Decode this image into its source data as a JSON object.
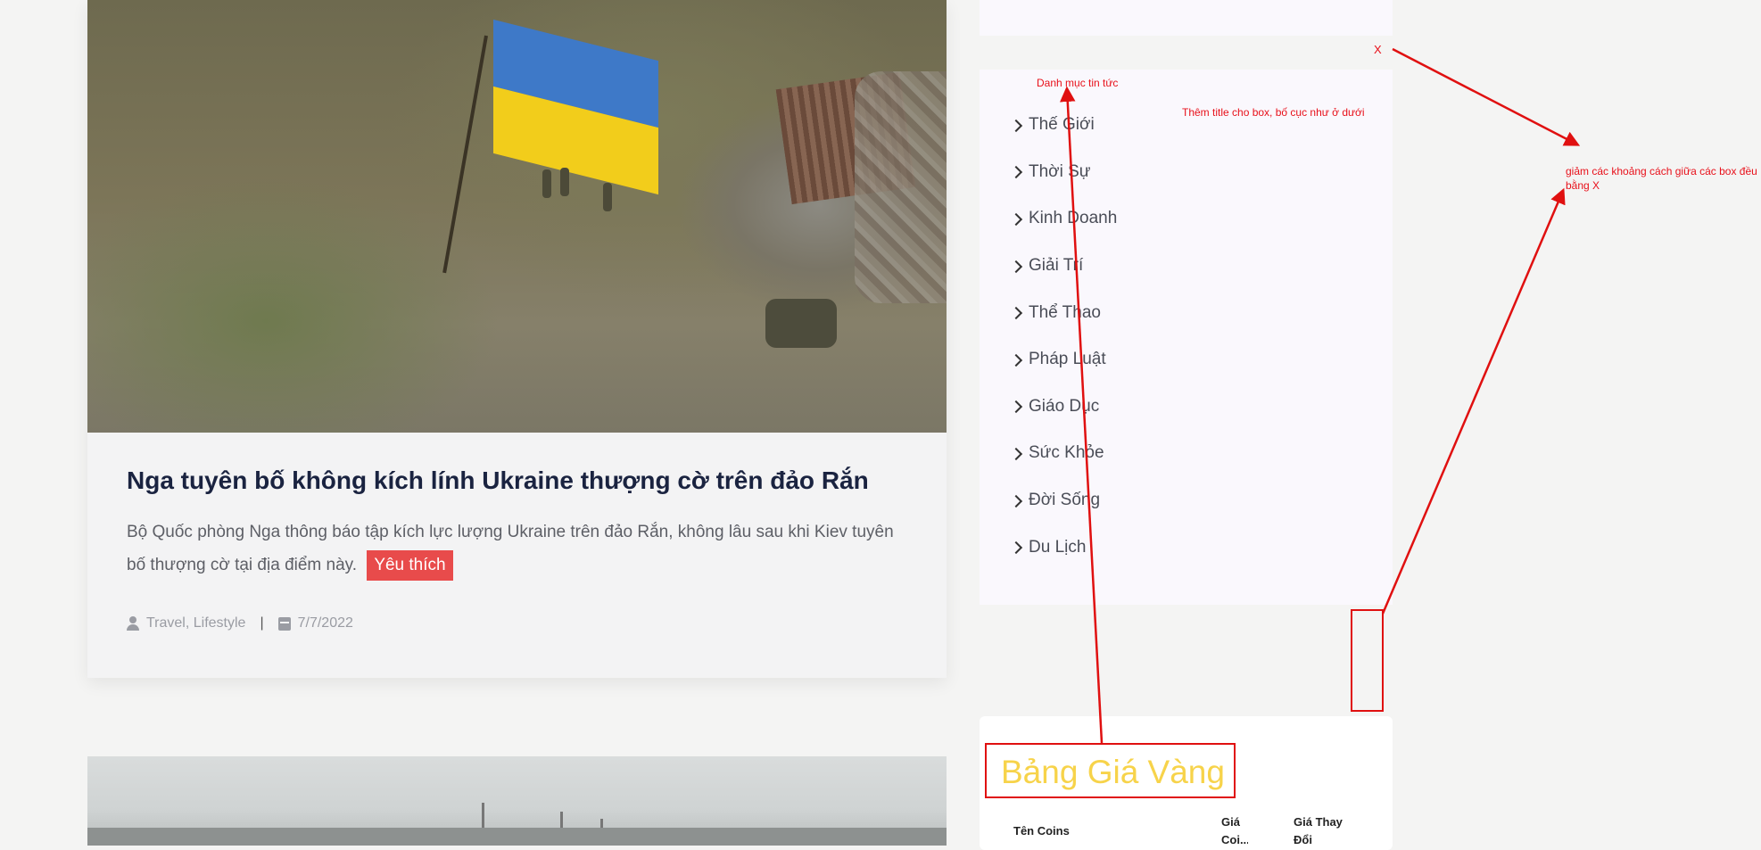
{
  "article": {
    "title": "Nga tuyên bố không kích lính Ukraine thượng cờ trên đảo Rắn",
    "excerpt": "Bộ Quốc phòng Nga thông báo tập kích lực lượng Ukraine trên đảo Rắn, không lâu sau khi Kiev tuyên bố thượng cờ tại địa điểm này.",
    "badge": "Yêu thích",
    "category": "Travel, Lifestyle",
    "separator": "|",
    "date": "7/7/2022"
  },
  "sidebar": {
    "categories": [
      {
        "label": "Thế Giới"
      },
      {
        "label": "Thời Sự"
      },
      {
        "label": "Kinh Doanh"
      },
      {
        "label": "Giải Trí"
      },
      {
        "label": "Thể Thao"
      },
      {
        "label": "Pháp Luật"
      },
      {
        "label": "Giáo Dục"
      },
      {
        "label": "Sức Khỏe"
      },
      {
        "label": "Đời Sống"
      },
      {
        "label": "Du Lịch"
      }
    ],
    "gold": {
      "title": "Bảng Giá Vàng",
      "columns": [
        "Tên Coins",
        "Giá Coi...",
        "Giá Thay Đổi"
      ]
    }
  },
  "annotations": {
    "x_marker": "X",
    "category_title_note": "Danh mục tin tức",
    "box_title_note": "Thêm title cho box, bố cục như ở dưới",
    "spacing_note": "giảm các khoảng cách giữa các box đều bằng X",
    "color": "#e8101a"
  },
  "colors": {
    "title": "#1a2340",
    "badge": "#e84b4b",
    "gold_title": "#f7d34a",
    "sidebar_bg": "#faf8fd"
  }
}
